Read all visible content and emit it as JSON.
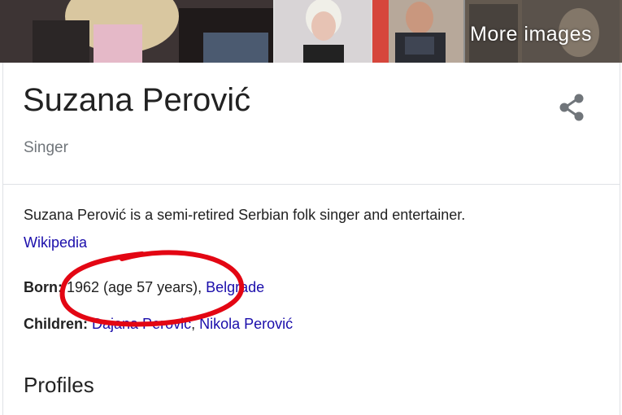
{
  "images": {
    "more_label": "More images"
  },
  "entity": {
    "name": "Suzana Perović",
    "subtitle": "Singer"
  },
  "description": {
    "text": "Suzana Perović is a semi-retired Serbian folk singer and entertainer.",
    "source_link": "Wikipedia"
  },
  "facts": {
    "born": {
      "label": "Born:",
      "value": " 1962 (age 57 years), ",
      "place": "Belgrade"
    },
    "children": {
      "label": "Children:",
      "child1": "Dajana Perović",
      "sep": ", ",
      "child2": "Nikola Perović"
    }
  },
  "profiles": {
    "heading": "Profiles"
  },
  "annotation": {
    "color": "#e30613"
  }
}
